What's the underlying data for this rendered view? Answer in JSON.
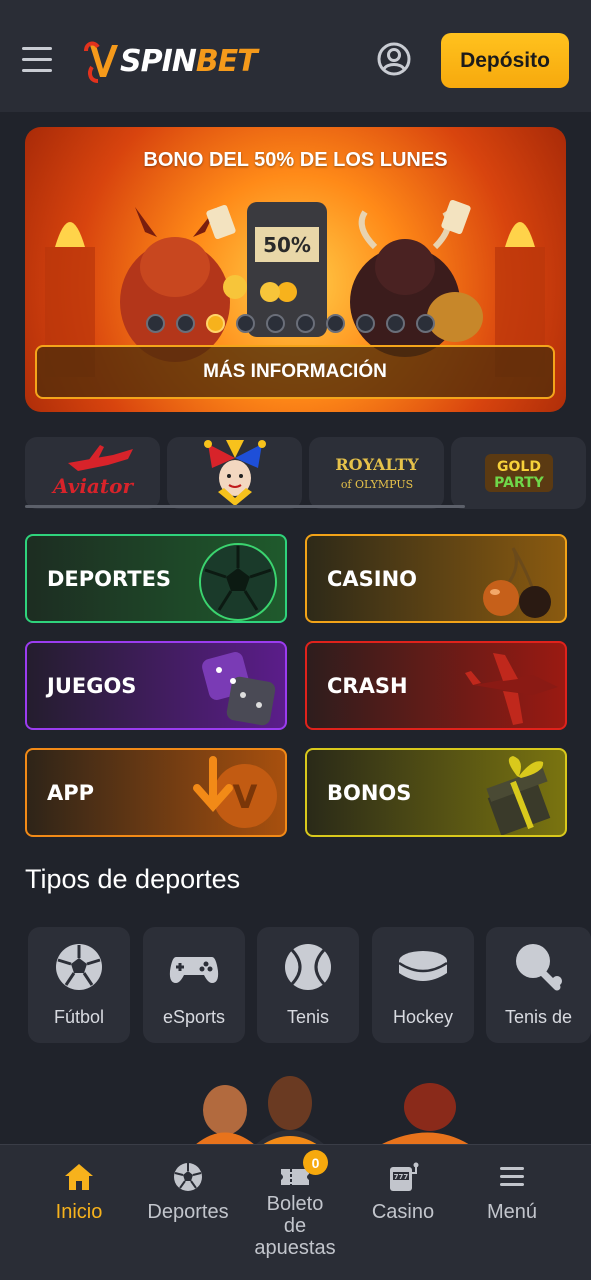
{
  "header": {
    "logo_text_spin": "SPIN",
    "logo_text_bet": "BET",
    "deposit_label": "Depósito"
  },
  "banner": {
    "title": "BONO DEL 50% DE LOS LUNES",
    "slot_text": "50%",
    "more_info_label": "MÁS INFORMACIÓN",
    "slide_count": 10,
    "active_slide": 3
  },
  "providers": [
    {
      "name": "Aviator"
    },
    {
      "name": "Jester"
    },
    {
      "name": "ROYALTY of OLYMPUS",
      "line1": "ROYALTY",
      "line2": "of OLYMPUS"
    },
    {
      "name": "GOLD PARTY",
      "line1": "GOLD",
      "line2": "PARTY"
    }
  ],
  "categories": [
    {
      "label": "DEPORTES",
      "color": "#2fd37c"
    },
    {
      "label": "CASINO",
      "color": "#f2a318"
    },
    {
      "label": "JUEGOS",
      "color": "#9b3cf0"
    },
    {
      "label": "CRASH",
      "color": "#e0221c"
    },
    {
      "label": "APP",
      "color": "#f28a17"
    },
    {
      "label": "BONOS",
      "color": "#d9c91c"
    }
  ],
  "sports_section": {
    "title": "Tipos de deportes",
    "items": [
      {
        "label": "Fútbol",
        "icon": "soccer-ball-icon"
      },
      {
        "label": "eSports",
        "icon": "gamepad-icon"
      },
      {
        "label": "Tenis",
        "icon": "tennis-ball-icon"
      },
      {
        "label": "Hockey",
        "icon": "hockey-puck-icon"
      },
      {
        "label": "Tenis de",
        "icon": "table-tennis-icon"
      }
    ]
  },
  "bottom_nav": {
    "items": [
      {
        "label": "Inicio",
        "icon": "home-icon",
        "active": true
      },
      {
        "label": "Deportes",
        "icon": "soccer-ball-icon"
      },
      {
        "label_line1": "Boleto",
        "label_line2": "de",
        "label_line3": "apuestas",
        "icon": "ticket-icon",
        "badge": "0"
      },
      {
        "label": "Casino",
        "icon": "slot-machine-icon"
      },
      {
        "label": "Menú",
        "icon": "menu-icon"
      }
    ]
  },
  "colors": {
    "accent": "#f7b21c",
    "background": "#20232b",
    "header": "#2a2d36",
    "card": "#2c2f38"
  }
}
